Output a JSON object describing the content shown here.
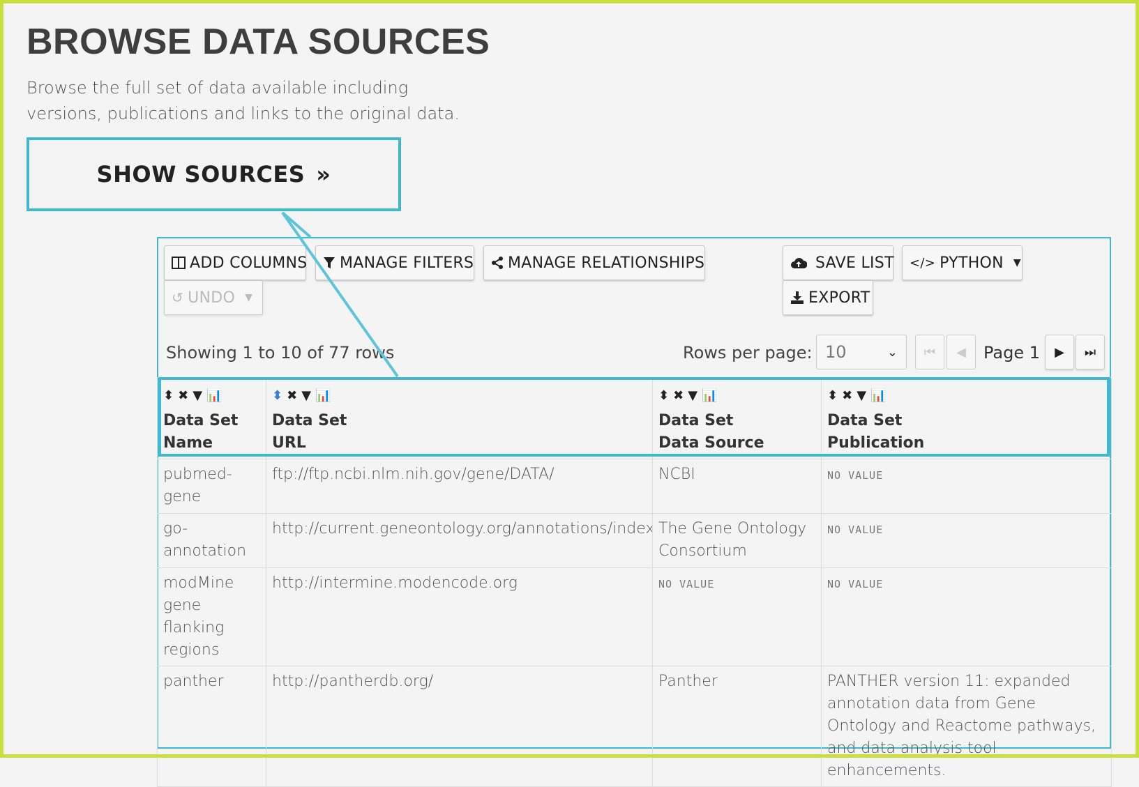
{
  "page": {
    "title": "BROWSE DATA SOURCES",
    "description": "Browse the full set of data available including versions, publications and links to the original data.",
    "show_sources": "SHOW SOURCES",
    "show_sources_chevron": "»"
  },
  "toolbar": {
    "add_columns": "ADD COLUMNS",
    "manage_filters": "MANAGE FILTERS",
    "manage_relationships": "MANAGE RELATIONSHIPS",
    "undo": "UNDO",
    "save_list": "SAVE LIST",
    "python": "PYTHON",
    "export": "EXPORT"
  },
  "pagination": {
    "showing": "Showing 1 to 10 of 77 rows",
    "rows_per_page_label": "Rows per page:",
    "rows_per_page_value": "10",
    "page_label": "Page 1"
  },
  "table": {
    "columns": [
      {
        "line1": "Data Set",
        "line2": "Name"
      },
      {
        "line1": "Data Set",
        "line2": "URL"
      },
      {
        "line1": "Data Set",
        "line2": "Data Source"
      },
      {
        "line1": "Data Set",
        "line2": "Publication"
      }
    ],
    "no_value": "NO VALUE",
    "rows": [
      {
        "name": "pubmed-gene",
        "url": "ftp://ftp.ncbi.nlm.nih.gov/gene/DATA/",
        "source": "NCBI",
        "publication": ""
      },
      {
        "name": "go-annotation",
        "url": "http://current.geneontology.org/annotations/index.html",
        "source": "The Gene Ontology Consortium",
        "publication": ""
      },
      {
        "name": "modMine gene flanking regions",
        "url": "http://intermine.modencode.org",
        "source": "",
        "publication": ""
      },
      {
        "name": "panther",
        "url": "http://pantherdb.org/",
        "source": "Panther",
        "publication": "PANTHER version 11: expanded annotation data from Gene Ontology and Reactome pathways, and data analysis tool enhancements."
      }
    ]
  },
  "colors": {
    "accent": "#3fb9cf",
    "frame": "#c8e03c"
  }
}
